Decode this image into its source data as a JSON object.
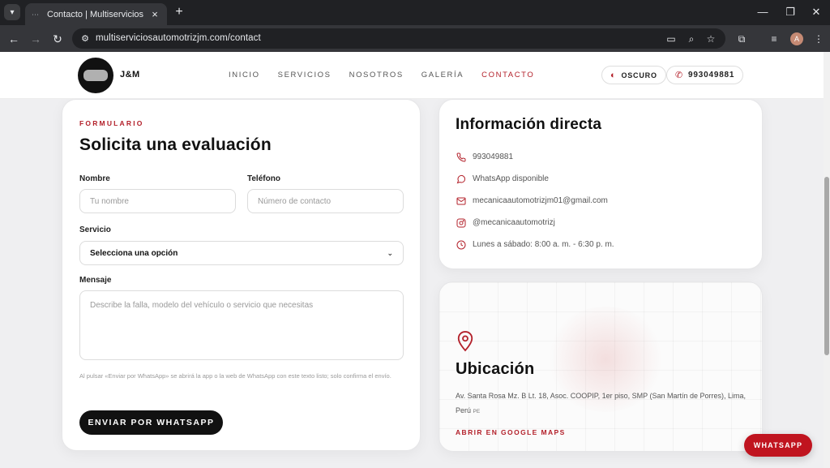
{
  "browser": {
    "tab_title": "Contacto | Multiservicios Automotriz J&M",
    "url": "multiserviciosautomotrizjm.com/contact",
    "profile_initial": "A"
  },
  "site": {
    "brand": "J&M",
    "nav": [
      "INICIO",
      "SERVICIOS",
      "NOSOTROS",
      "GALERÍA",
      "CONTACTO"
    ],
    "active_nav": "CONTACTO",
    "theme_label": "OSCURO",
    "phone_pill": "993049881"
  },
  "form": {
    "eyebrow": "FORMULARIO",
    "title": "Solicita una evaluación",
    "name_label": "Nombre",
    "name_placeholder": "Tu nombre",
    "phone_label": "Teléfono",
    "phone_placeholder": "Número de contacto",
    "service_label": "Servicio",
    "service_value": "Selecciona una opción",
    "message_label": "Mensaje",
    "message_placeholder": "Describe la falla, modelo del vehículo o servicio que necesitas",
    "note": "Al pulsar «Enviar por WhatsApp» se abrirá la app o la web de WhatsApp con este texto listo; solo confirma el envío.",
    "submit_label": "ENVIAR POR WHATSAPP"
  },
  "info": {
    "title": "Información directa",
    "phone": "993049881",
    "whatsapp": "WhatsApp disponible",
    "email": "mecanicaautomotrizjm01@gmail.com",
    "instagram": "@mecanicaautomotrizj",
    "hours": "Lunes a sábado: 8:00 a. m. - 6:30 p. m."
  },
  "location": {
    "title": "Ubicación",
    "address": "Av. Santa Rosa Mz. B Lt. 18, Asoc. COOPIP, 1er piso, SMP (San Martín de Porres), Lima, Perú",
    "country_code": "PE",
    "maps_link": "ABRIR EN GOOGLE MAPS"
  },
  "floating_button": "WHATSAPP",
  "colors": {
    "accent": "#b3202a",
    "dark": "#111111",
    "whatsapp_button": "#c0141f"
  }
}
